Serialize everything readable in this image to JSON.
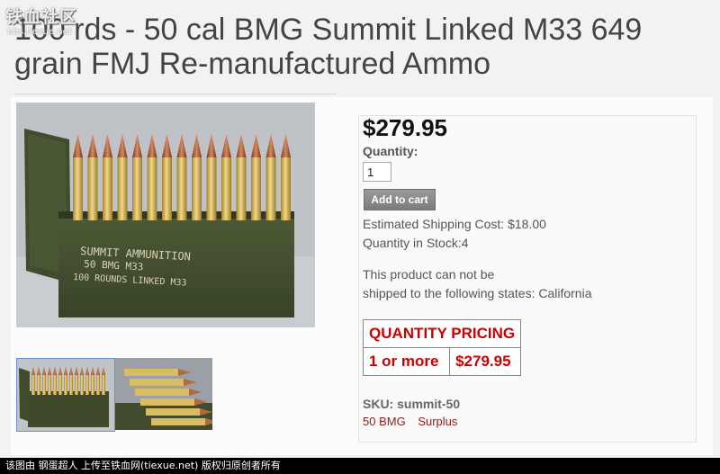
{
  "watermark": {
    "logo_text": "铁血社区",
    "sub_text": "bbs.tiexue.net"
  },
  "product": {
    "title": "100 rds - 50 cal BMG Summit Linked M33 649 grain FMJ Re-manufactured Ammo",
    "price": "$279.95",
    "quantity_label": "Quantity:",
    "quantity_value": "1",
    "add_to_cart_label": "Add to cart",
    "shipping_cost": "Estimated Shipping Cost: $18.00",
    "stock": "Quantity in Stock:4",
    "restriction_line1": "This product can not be",
    "restriction_line2": "shipped to the following states: California",
    "sku": "SKU: summit-50",
    "tags": [
      "50 BMG",
      "Surplus"
    ],
    "image_texts": [
      "SUMMIT AMMUNITION",
      "50 BMG M33",
      "100 ROUNDS LINKED M33"
    ]
  },
  "quantity_pricing": {
    "header": "QUANTITY PRICING",
    "rows": [
      {
        "quantity": "1 or more",
        "price": "$279.95"
      }
    ]
  },
  "footer": {
    "text": "该图由 钢蛋超人 上传至铁血网(tiexue.net) 版权归原创者所有"
  },
  "colors": {
    "price_accent": "#cc0000",
    "tag_link": "#8a1a1a",
    "button_gray": "#888888"
  }
}
